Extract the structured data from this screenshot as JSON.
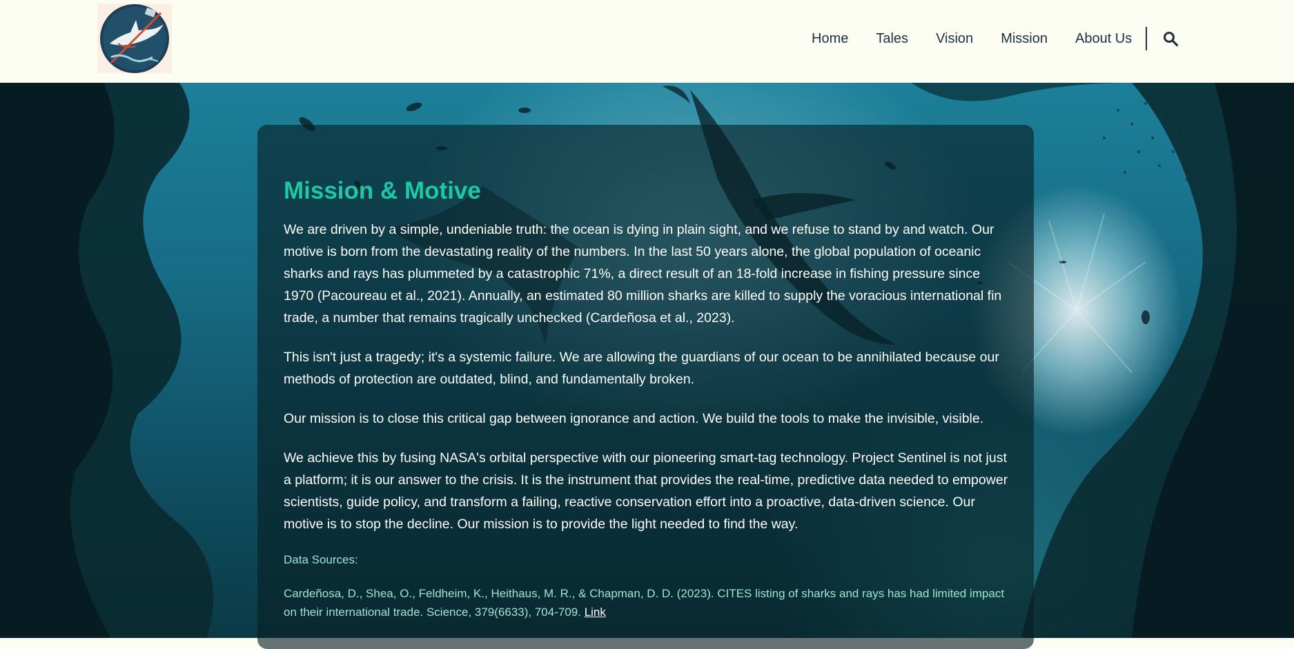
{
  "header": {
    "logo_name": "shark-logo",
    "nav": [
      "Home",
      "Tales",
      "Vision",
      "Mission",
      "About Us"
    ],
    "search_icon": "search-icon"
  },
  "content": {
    "title": "Mission & Motive",
    "paragraphs": [
      "We are driven by a simple, undeniable truth: the ocean is dying in plain sight, and we refuse to stand by and watch. Our motive is born from the devastating reality of the numbers. In the last 50 years alone, the global population of oceanic sharks and rays has plummeted by a catastrophic 71%, a direct result of an 18-fold increase in fishing pressure since 1970 (Pacoureau et al., 2021). Annually, an estimated 80 million sharks are killed to supply the voracious international fin trade, a number that remains tragically unchecked (Cardeñosa et al., 2023).",
      "This isn't just a tragedy; it's a systemic failure. We are allowing the guardians of our ocean to be annihilated because our methods of protection are outdated, blind, and fundamentally broken.",
      "Our mission is to close this critical gap between ignorance and action. We build the tools to make the invisible, visible.",
      "We achieve this by fusing NASA's orbital perspective with our pioneering smart-tag technology. Project Sentinel is not just a platform; it is our answer to the crisis. It is the instrument that provides the real-time, predictive data needed to empower scientists, guide policy, and transform a failing, reactive conservation effort into a proactive, data-driven science. Our motive is to stop the decline. Our mission is to provide the light needed to find the way."
    ],
    "sources_heading": "Data Sources:",
    "citation_text": "Cardeñosa, D., Shea, O., Feldheim, K., Heithaus, M. R., & Chapman, D. D. (2023). CITES listing of sharks and rays has had limited impact on their international trade. Science, 379(6633), 704-709.",
    "citation_link": "Link"
  },
  "colors": {
    "accent": "#1fc8a4",
    "nav_text": "#1e2f3e",
    "header_bg": "#fdfef3"
  }
}
